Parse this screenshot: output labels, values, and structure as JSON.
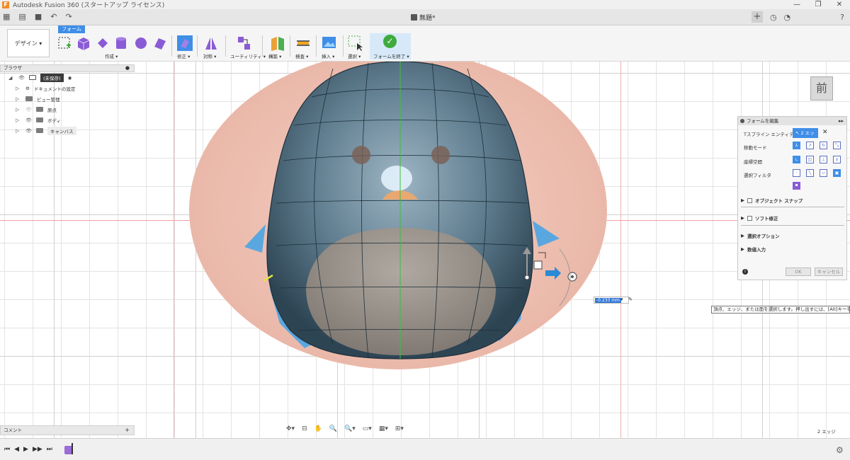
{
  "window": {
    "title": "Autodesk Fusion 360 (スタートアップ ライセンス)",
    "app_logo": "F",
    "minimize": "—",
    "maximize": "❐",
    "close": "✕"
  },
  "document_tab": {
    "name": "無題*",
    "close": "✕"
  },
  "quick_access": {
    "grid_icon": "▦",
    "file_icon": "▤",
    "save_icon": "■",
    "undo_icon": "↶",
    "redo_icon": "↷",
    "add_tab": "+"
  },
  "ribbon": {
    "workspace": "デザイン ▾",
    "active_tab": "フォーム",
    "groups": [
      "作成 ▾",
      "修正 ▾",
      "対称 ▾",
      "ユーティリティ ▾",
      "構築 ▾",
      "検査 ▾",
      "挿入 ▾",
      "選択 ▾",
      "フォームを終了 ▾"
    ]
  },
  "browser": {
    "title": "ブラウザ",
    "items": [
      {
        "label": "(未保存)"
      },
      {
        "label": "ドキュメントの設定"
      },
      {
        "label": "ビュー管理"
      },
      {
        "label": "原点"
      },
      {
        "label": "ボディ"
      },
      {
        "label": "キャンバス"
      }
    ]
  },
  "comment": {
    "label": "コメント",
    "add": "+"
  },
  "viewcube": {
    "face": "前",
    "axis": "Z"
  },
  "edit_form": {
    "title": "フォームを編集",
    "entity_label": "Tスプライン エンティティ",
    "selection_value": "2 エッジ",
    "transform_mode_label": "移動モード",
    "coordinate_space_label": "座標空間",
    "selection_filter_label": "選択フィルタ",
    "object_snap": "オブジェクト スナップ",
    "soft_modify": "ソフト修正",
    "selection_options": "選択オプション",
    "numeric_input": "数値入力",
    "ok": "OK",
    "cancel": "キャンセル"
  },
  "value_input": {
    "value": "-0.233 mm"
  },
  "tooltip": {
    "text": "頂点、エッジ、または面を選択します。押し出すには、[Alt]キーを押"
  },
  "status": {
    "selection_count": "2 エッジ"
  }
}
